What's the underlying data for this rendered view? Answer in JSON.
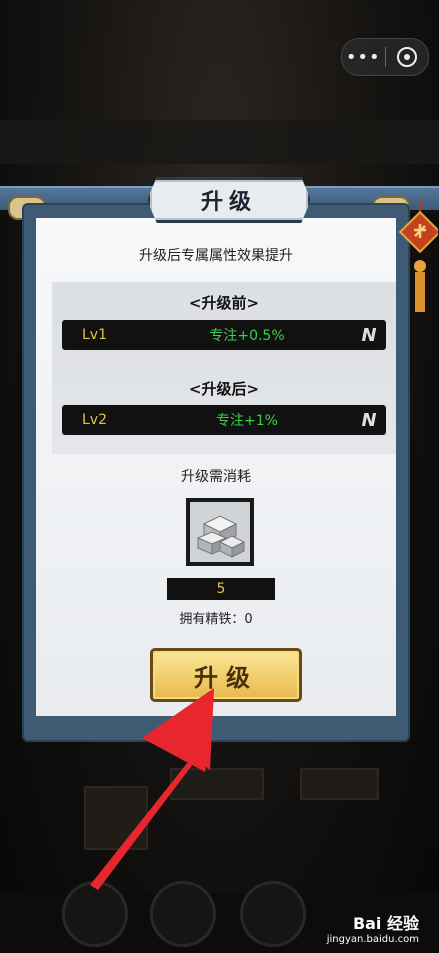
{
  "capsule": {
    "more_label": "•••"
  },
  "dialog": {
    "title": "升级",
    "subtitle": "升级后专属属性效果提升",
    "before_title": "<升级前>",
    "after_title": "<升级后>",
    "before": {
      "level": "Lv1",
      "effect": "专注+0.5%"
    },
    "after": {
      "level": "Lv2",
      "effect": "专注+1%"
    },
    "cost_title": "升级需消耗",
    "cost_count": "5",
    "owned_text": "拥有精铁：0",
    "upgrade_button": "升级"
  },
  "watermark": {
    "brand": "Bai 经验",
    "url": "jingyan.baidu.com"
  },
  "colors": {
    "accent_gold": "#e7b94a",
    "effect_green": "#3ad04a",
    "level_yellow": "#e0c640",
    "frame_blue": "#3f5b74"
  }
}
